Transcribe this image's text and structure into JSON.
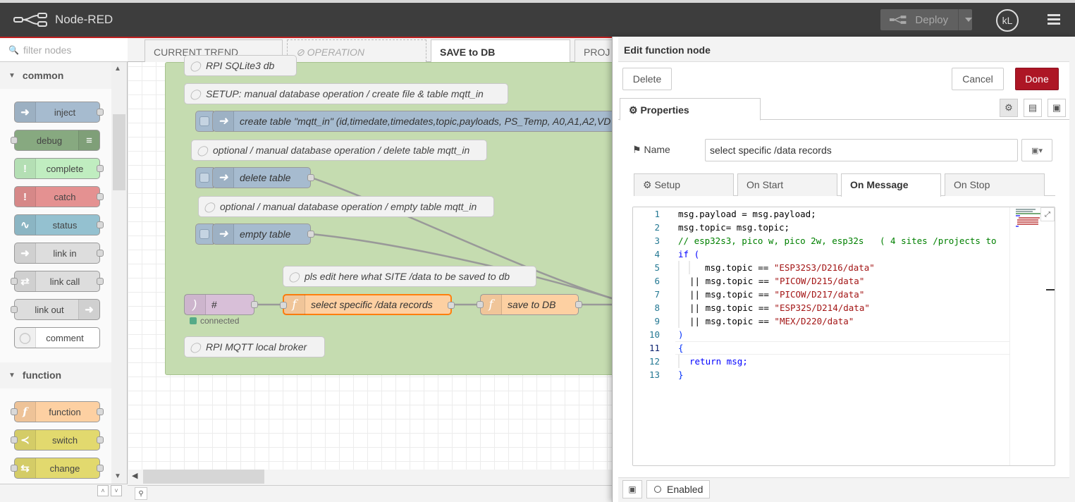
{
  "header": {
    "app_title": "Node-RED",
    "deploy_label": "Deploy",
    "user_initials": "kL"
  },
  "palette": {
    "search_placeholder": "filter nodes",
    "categories": [
      {
        "label": "common",
        "nodes": [
          {
            "label": "inject",
            "color": "#a6bbcf"
          },
          {
            "label": "debug",
            "color": "#87a980"
          },
          {
            "label": "complete",
            "color": "#c0edc0"
          },
          {
            "label": "catch",
            "color": "#e49191"
          },
          {
            "label": "status",
            "color": "#94c1d0"
          },
          {
            "label": "link in",
            "color": "#dddddd"
          },
          {
            "label": "link call",
            "color": "#dddddd"
          },
          {
            "label": "link out",
            "color": "#dddddd"
          },
          {
            "label": "comment",
            "color": "#ffffff"
          }
        ]
      },
      {
        "label": "function",
        "nodes": [
          {
            "label": "function",
            "color": "#fdd0a2"
          },
          {
            "label": "switch",
            "color": "#e2d96e"
          },
          {
            "label": "change",
            "color": "#e2d96e"
          }
        ]
      }
    ]
  },
  "workspace": {
    "tabs": [
      {
        "label": "CURRENT TREND",
        "state": "normal"
      },
      {
        "label": "OPERATION",
        "state": "disabled"
      },
      {
        "label": "SAVE to DB",
        "state": "active"
      },
      {
        "label": "PROJ",
        "state": "normal"
      }
    ],
    "comments": [
      "RPI SQLite3 db",
      "SETUP: manual database operation / create file & table mqtt_in",
      "optional / manual database operation / delete table mqtt_in",
      "optional / manual database operation / empty table mqtt_in",
      "pls edit here what SITE /data to be saved to db",
      "RPI MQTT local broker"
    ],
    "inject_nodes": [
      "create table \"mqtt_in\" (id,timedate,timedates,topic,payloads, PS_Temp, A0,A1,A2,VD",
      "delete table",
      "empty table"
    ],
    "mqtt_node": {
      "label": "#",
      "status": "connected",
      "color": "#d8bfd8",
      "status_color": "#5a8"
    },
    "function_nodes": [
      {
        "label": "select specific /data records",
        "color": "#fdd0a2"
      },
      {
        "label": "save to DB",
        "color": "#fdd0a2"
      }
    ]
  },
  "tray": {
    "title": "Edit function node",
    "delete_label": "Delete",
    "cancel_label": "Cancel",
    "done_label": "Done",
    "properties_tab": "Properties",
    "name_label": "Name",
    "name_value": "select specific /data records",
    "code_tabs": [
      "Setup",
      "On Start",
      "On Message",
      "On Stop"
    ],
    "active_code_tab": "On Message",
    "code_lines": [
      "msg.payload = msg.payload;",
      "msg.topic= msg.topic;",
      "// esp32s3, pico w, pico 2w, esp32s   ( 4 sites /projects to",
      "if (",
      "msg.topic == \"ESP32S3/D216/data\"",
      "|| msg.topic == \"PICOW/D215/data\"",
      "|| msg.topic == \"PICOW/D217/data\"",
      "|| msg.topic == \"ESP32S/D214/data\"",
      "|| msg.topic == \"MEX/D220/data\"",
      ")",
      "{",
      "return msg;",
      "}"
    ],
    "enabled_label": "Enabled"
  }
}
